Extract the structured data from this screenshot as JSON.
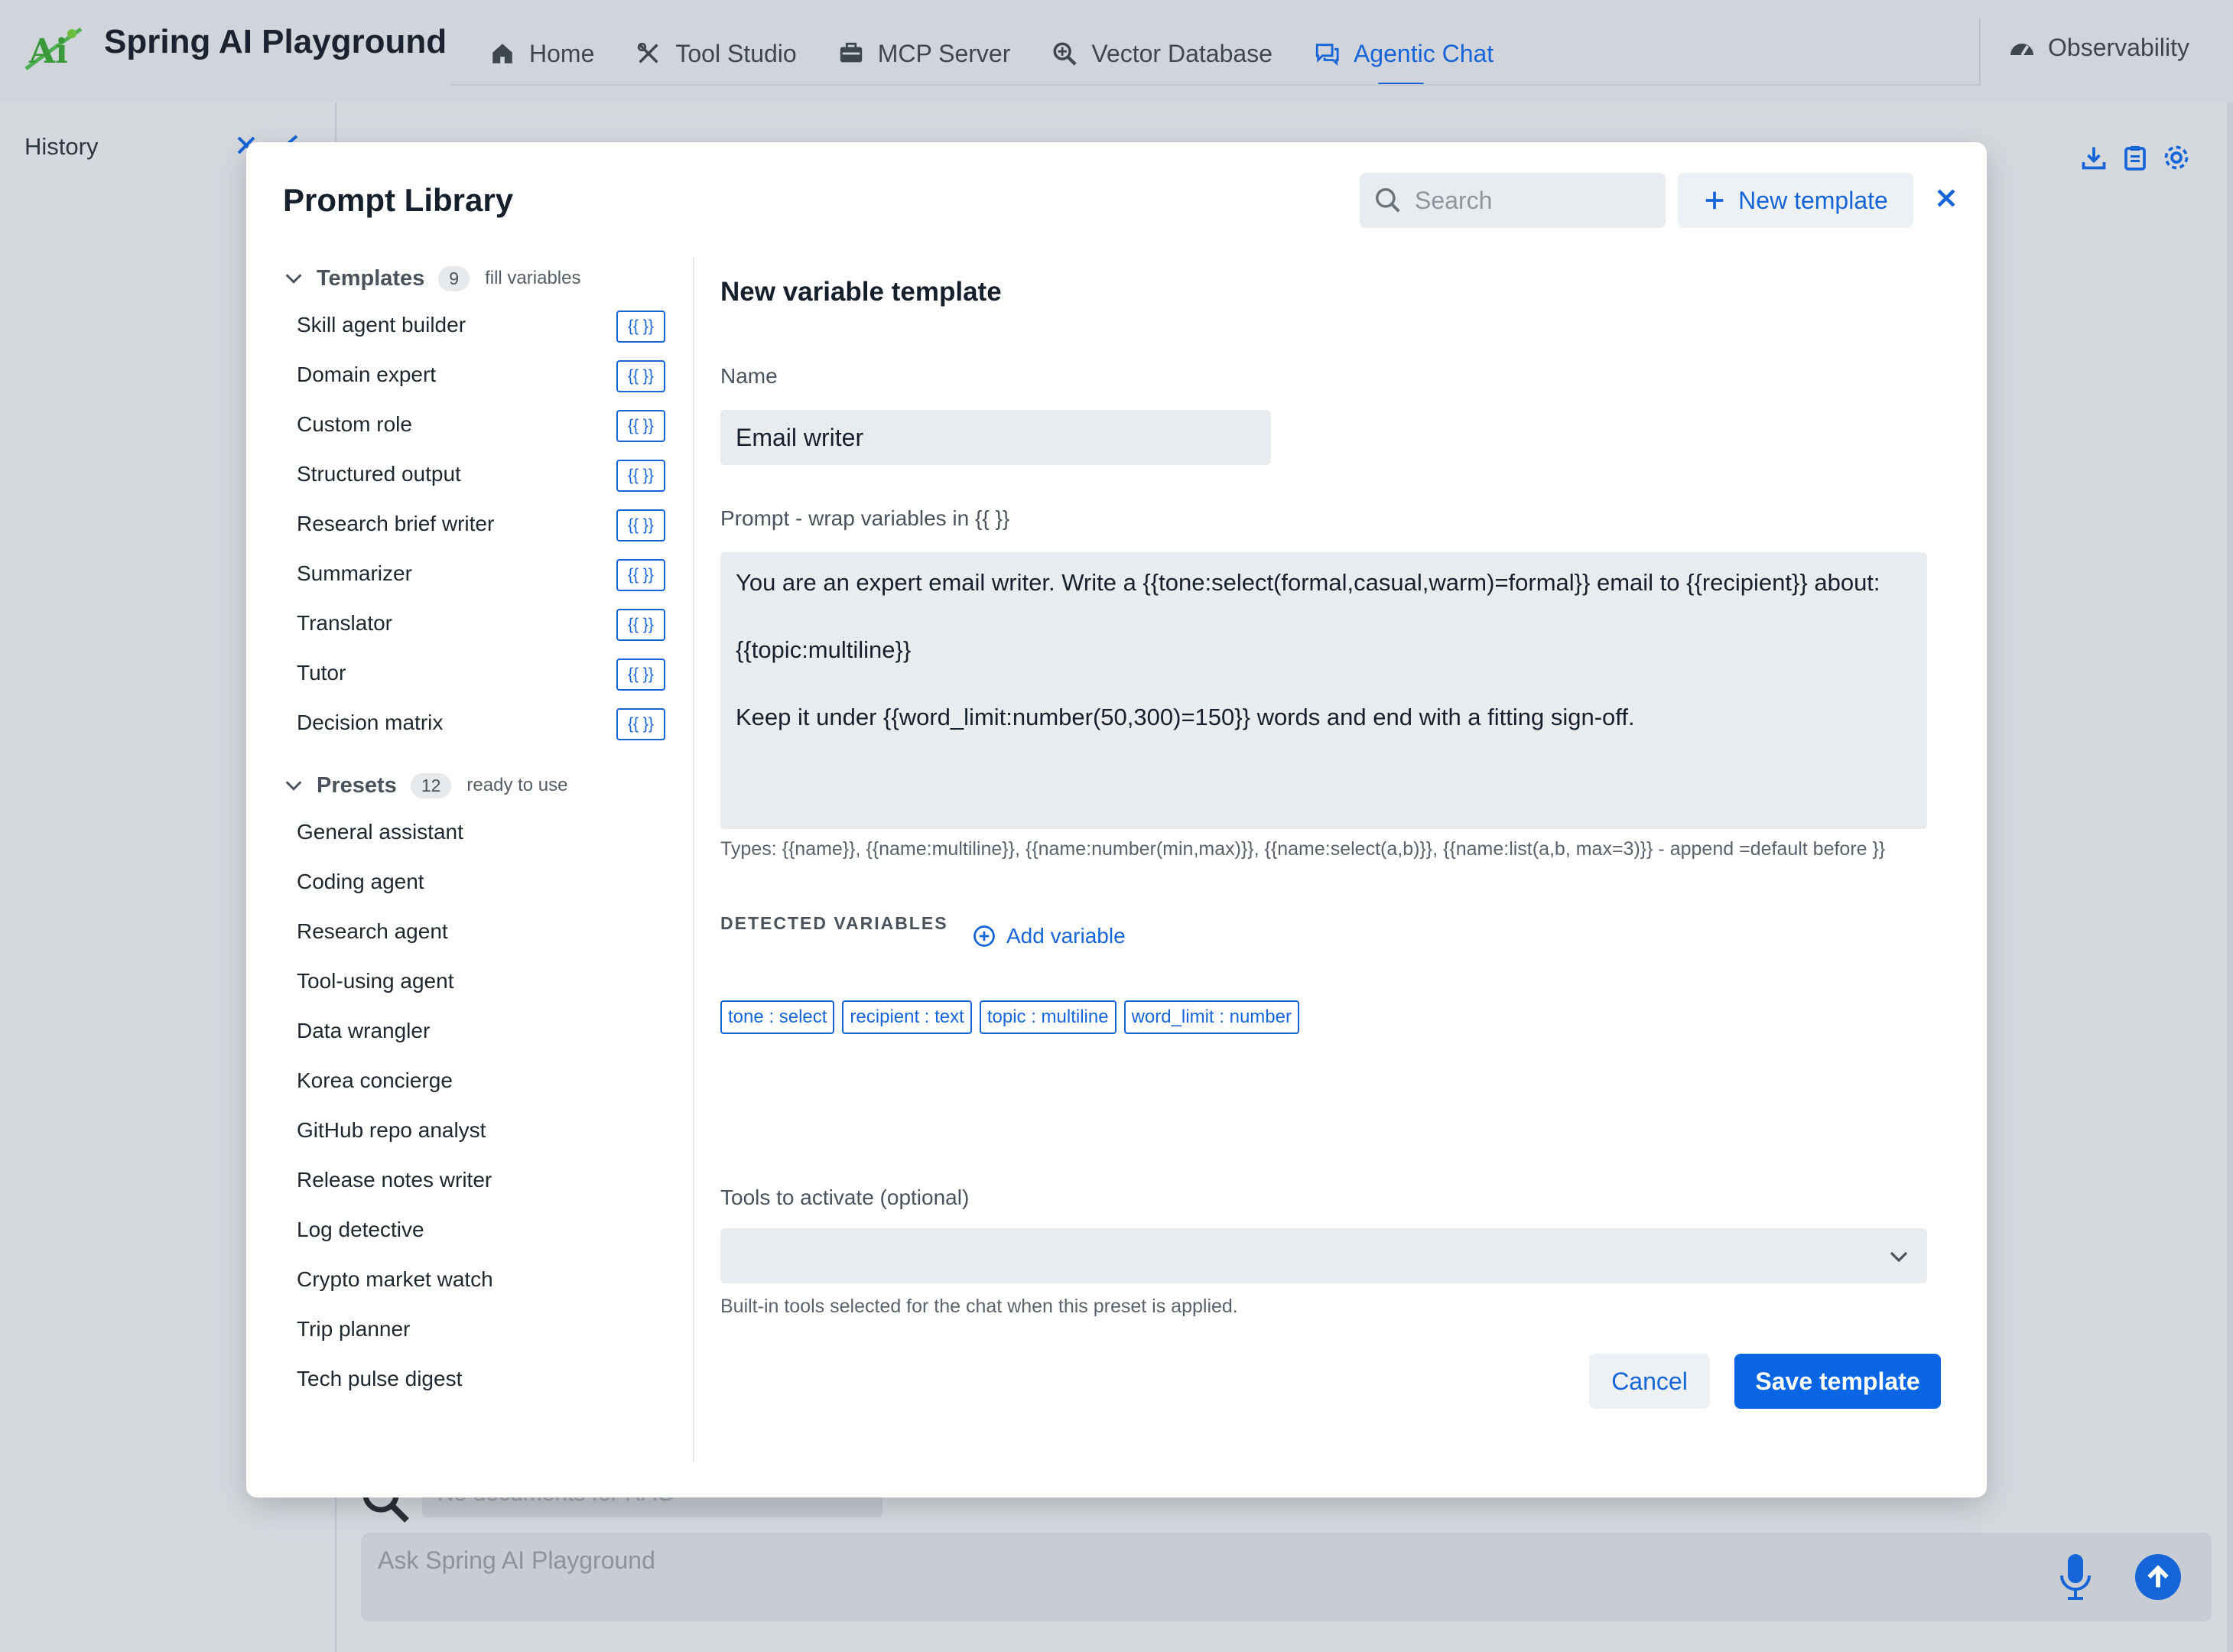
{
  "app": {
    "title": "Spring AI Playground",
    "nav": [
      {
        "label": "Home",
        "icon": "home-icon"
      },
      {
        "label": "Tool Studio",
        "icon": "tools-icon"
      },
      {
        "label": "MCP Server",
        "icon": "server-icon"
      },
      {
        "label": "Vector Database",
        "icon": "search-database-icon"
      },
      {
        "label": "Agentic Chat",
        "icon": "chat-icon",
        "active": true
      }
    ],
    "observability": "Observability",
    "history": "History",
    "docs_placeholder": "No documents for RAG",
    "ask_placeholder": "Ask Spring AI Playground"
  },
  "modal": {
    "title": "Prompt Library",
    "search_placeholder": "Search",
    "new_template": "New template",
    "templates": {
      "title": "Templates",
      "count": "9",
      "hint": "fill variables",
      "badge": "{{ }}",
      "items": [
        "Skill agent builder",
        "Domain expert",
        "Custom role",
        "Structured output",
        "Research brief writer",
        "Summarizer",
        "Translator",
        "Tutor",
        "Decision matrix"
      ]
    },
    "presets": {
      "title": "Presets",
      "count": "12",
      "hint": "ready to use",
      "items": [
        "General assistant",
        "Coding agent",
        "Research agent",
        "Tool-using agent",
        "Data wrangler",
        "Korea concierge",
        "GitHub repo analyst",
        "Release notes writer",
        "Log detective",
        "Crypto market watch",
        "Trip planner",
        "Tech pulse digest"
      ]
    },
    "form": {
      "title": "New variable template",
      "name_label": "Name",
      "name_value": "Email writer",
      "prompt_label": "Prompt - wrap variables in {{ }}",
      "prompt_value": "You are an expert email writer. Write a {{tone:select(formal,casual,warm)=formal}} email to {{recipient}} about:\n\n{{topic:multiline}}\n\nKeep it under {{word_limit:number(50,300)=150}} words and end with a fitting sign-off.",
      "types_hint": "Types: {{name}}, {{name:multiline}}, {{name:number(min,max)}}, {{name:select(a,b)}}, {{name:list(a,b, max=3)}} - append =default before }}",
      "detected_label": "DETECTED VARIABLES",
      "add_variable": "Add variable",
      "chips": [
        "tone : select",
        "recipient : text",
        "topic : multiline",
        "word_limit : number"
      ],
      "tools_label": "Tools to activate (optional)",
      "tools_hint": "Built-in tools selected for the chat when this preset is applied.",
      "cancel": "Cancel",
      "save": "Save template"
    }
  },
  "colors": {
    "accent": "#1565d8",
    "save_button": "#0b66e4",
    "field_bg": "#e9ecef",
    "backdrop": "#d5d9de"
  }
}
